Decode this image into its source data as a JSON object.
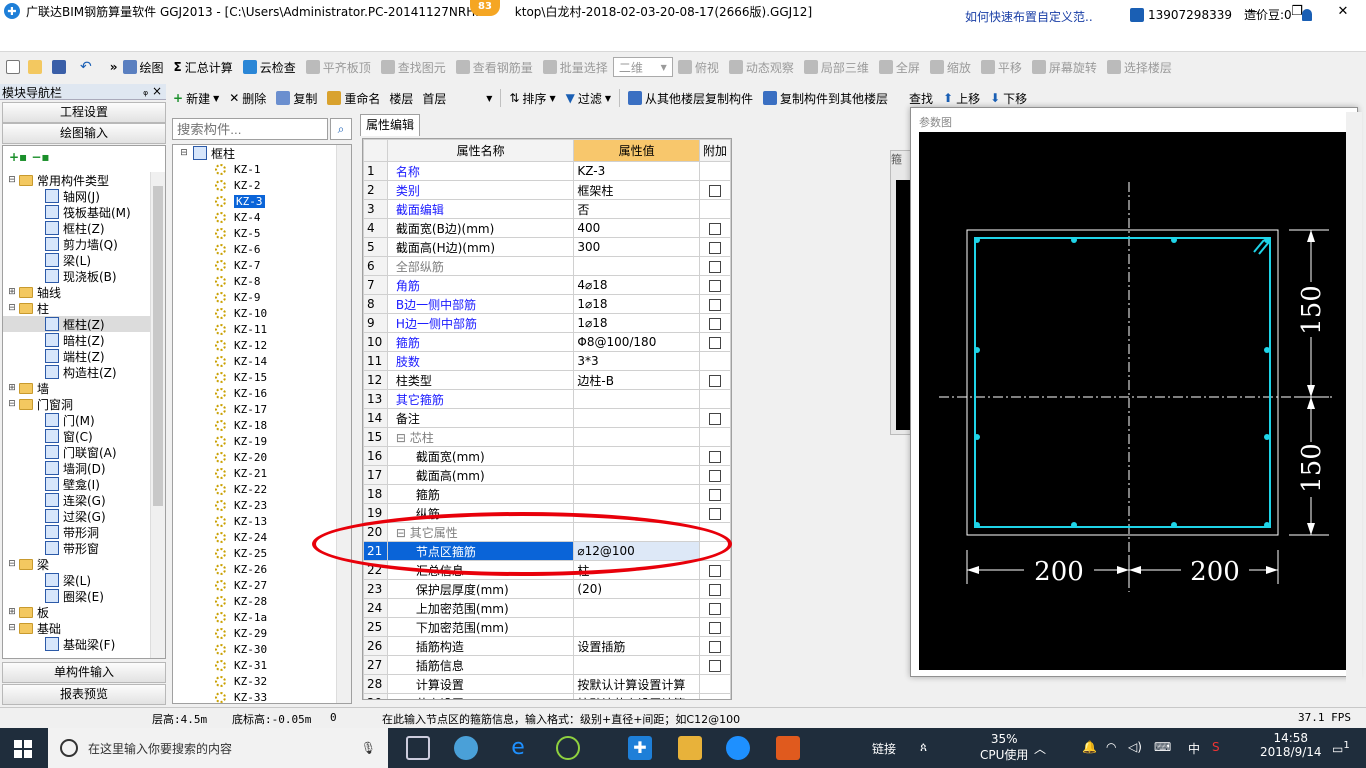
{
  "window": {
    "title": "广联达BIM钢筋算量软件 GGJ2013 - [C:\\Users\\Administrator.PC-20141127NRHI",
    "title_tail": "ktop\\白龙村-2018-02-03-20-08-17(2666版).GGJ12]",
    "badge": "83",
    "min": "—",
    "max": "❐",
    "close": "✕"
  },
  "infobar": {
    "tip": "如何快速布置自定义范..",
    "phone": "13907298339",
    "coins": "造价豆:0"
  },
  "toolbar1": {
    "draw": "绘图",
    "sum": "汇总计算",
    "cloud": "云检查",
    "flat": "平齐板顶",
    "find": "查找图元",
    "view_rebar": "查看钢筋量",
    "batch": "批量选择",
    "view2d": "二维",
    "topview": "俯视",
    "dynamic": "动态观察",
    "local3d": "局部三维",
    "fullscreen": "全屏",
    "zoom": "缩放",
    "pan": "平移",
    "rotate": "屏幕旋转",
    "select_floor": "选择楼层"
  },
  "toolbar2": {
    "new": "新建",
    "delete": "删除",
    "copy": "复制",
    "rename": "重命名",
    "floor_label": "楼层",
    "floor_value": "首层",
    "sort": "排序",
    "filter": "过滤",
    "copy_from": "从其他楼层复制构件",
    "copy_to": "复制构件到其他楼层",
    "find": "查找",
    "up": "上移",
    "down": "下移"
  },
  "nav": {
    "header": "模块导航栏",
    "pin": "ᵩ ×",
    "project_settings": "工程设置",
    "draw_input": "绘图输入",
    "single_input": "单构件输入",
    "report": "报表预览",
    "tree": [
      {
        "level": 0,
        "exp": "⊟",
        "type": "folder",
        "label": "常用构件类型"
      },
      {
        "level": 1,
        "exp": "",
        "type": "icon",
        "label": "轴网(J)"
      },
      {
        "level": 1,
        "exp": "",
        "type": "icon",
        "label": "筏板基础(M)"
      },
      {
        "level": 1,
        "exp": "",
        "type": "icon",
        "label": "框柱(Z)"
      },
      {
        "level": 1,
        "exp": "",
        "type": "icon",
        "label": "剪力墙(Q)"
      },
      {
        "level": 1,
        "exp": "",
        "type": "icon",
        "label": "梁(L)"
      },
      {
        "level": 1,
        "exp": "",
        "type": "icon",
        "label": "现浇板(B)"
      },
      {
        "level": 0,
        "exp": "⊞",
        "type": "folder",
        "label": "轴线"
      },
      {
        "level": 0,
        "exp": "⊟",
        "type": "folder",
        "label": "柱"
      },
      {
        "level": 1,
        "exp": "",
        "type": "icon",
        "label": "框柱(Z)",
        "selected": true
      },
      {
        "level": 1,
        "exp": "",
        "type": "icon",
        "label": "暗柱(Z)"
      },
      {
        "level": 1,
        "exp": "",
        "type": "icon",
        "label": "端柱(Z)"
      },
      {
        "level": 1,
        "exp": "",
        "type": "icon",
        "label": "构造柱(Z)"
      },
      {
        "level": 0,
        "exp": "⊞",
        "type": "folder",
        "label": "墙"
      },
      {
        "level": 0,
        "exp": "⊟",
        "type": "folder",
        "label": "门窗洞"
      },
      {
        "level": 1,
        "exp": "",
        "type": "icon",
        "label": "门(M)"
      },
      {
        "level": 1,
        "exp": "",
        "type": "icon",
        "label": "窗(C)"
      },
      {
        "level": 1,
        "exp": "",
        "type": "icon",
        "label": "门联窗(A)"
      },
      {
        "level": 1,
        "exp": "",
        "type": "icon",
        "label": "墙洞(D)"
      },
      {
        "level": 1,
        "exp": "",
        "type": "icon",
        "label": "壁龛(I)"
      },
      {
        "level": 1,
        "exp": "",
        "type": "icon",
        "label": "连梁(G)"
      },
      {
        "level": 1,
        "exp": "",
        "type": "icon",
        "label": "过梁(G)"
      },
      {
        "level": 1,
        "exp": "",
        "type": "icon",
        "label": "带形洞"
      },
      {
        "level": 1,
        "exp": "",
        "type": "icon",
        "label": "带形窗"
      },
      {
        "level": 0,
        "exp": "⊟",
        "type": "folder",
        "label": "梁"
      },
      {
        "level": 1,
        "exp": "",
        "type": "icon",
        "label": "梁(L)"
      },
      {
        "level": 1,
        "exp": "",
        "type": "icon",
        "label": "圈梁(E)"
      },
      {
        "level": 0,
        "exp": "⊞",
        "type": "folder",
        "label": "板"
      },
      {
        "level": 0,
        "exp": "⊟",
        "type": "folder",
        "label": "基础"
      },
      {
        "level": 1,
        "exp": "",
        "type": "icon",
        "label": "基础梁(F)"
      }
    ]
  },
  "components": {
    "search_placeholder": "搜索构件...",
    "root": "框柱",
    "items": [
      "KZ-1",
      "KZ-2",
      "KZ-3",
      "KZ-4",
      "KZ-5",
      "KZ-6",
      "KZ-7",
      "KZ-8",
      "KZ-9",
      "KZ-10",
      "KZ-11",
      "KZ-12",
      "KZ-14",
      "KZ-15",
      "KZ-16",
      "KZ-17",
      "KZ-18",
      "KZ-19",
      "KZ-20",
      "KZ-21",
      "KZ-22",
      "KZ-23",
      "KZ-13",
      "KZ-24",
      "KZ-25",
      "KZ-26",
      "KZ-27",
      "KZ-28",
      "KZ-1a",
      "KZ-29",
      "KZ-30",
      "KZ-31",
      "KZ-32",
      "KZ-33"
    ],
    "selected": "KZ-3"
  },
  "props": {
    "tab": "属性编辑",
    "col_name": "属性名称",
    "col_value": "属性值",
    "col_add": "附加",
    "rows": [
      {
        "n": "1",
        "name": "名称",
        "value": "KZ-3",
        "cls": "blue",
        "cb": false,
        "indent": 0
      },
      {
        "n": "2",
        "name": "类别",
        "value": "框架柱",
        "cls": "blue",
        "cb": true,
        "indent": 0
      },
      {
        "n": "3",
        "name": "截面编辑",
        "value": "否",
        "cls": "blue",
        "cb": false,
        "indent": 0
      },
      {
        "n": "4",
        "name": "截面宽(B边)(mm)",
        "value": "400",
        "cls": "",
        "cb": true,
        "indent": 0
      },
      {
        "n": "5",
        "name": "截面高(H边)(mm)",
        "value": "300",
        "cls": "",
        "cb": true,
        "indent": 0
      },
      {
        "n": "6",
        "name": "全部纵筋",
        "value": "",
        "cls": "gray",
        "cb": true,
        "indent": 0
      },
      {
        "n": "7",
        "name": "角筋",
        "value": "4⌀18",
        "cls": "blue",
        "cb": true,
        "indent": 0
      },
      {
        "n": "8",
        "name": "B边一侧中部筋",
        "value": "1⌀18",
        "cls": "blue",
        "cb": true,
        "indent": 0
      },
      {
        "n": "9",
        "name": "H边一侧中部筋",
        "value": "1⌀18",
        "cls": "blue",
        "cb": true,
        "indent": 0
      },
      {
        "n": "10",
        "name": "箍筋",
        "value": "Φ8@100/180",
        "cls": "blue",
        "cb": true,
        "indent": 0
      },
      {
        "n": "11",
        "name": "肢数",
        "value": "3*3",
        "cls": "blue",
        "cb": false,
        "indent": 0
      },
      {
        "n": "12",
        "name": "柱类型",
        "value": "边柱-B",
        "cls": "",
        "cb": true,
        "indent": 0
      },
      {
        "n": "13",
        "name": "其它箍筋",
        "value": "",
        "cls": "blue",
        "cb": false,
        "indent": 0
      },
      {
        "n": "14",
        "name": "备注",
        "value": "",
        "cls": "",
        "cb": true,
        "indent": 0
      },
      {
        "n": "15",
        "name": "⊟ 芯柱",
        "value": "",
        "cls": "gray",
        "cb": false,
        "indent": 0
      },
      {
        "n": "16",
        "name": "截面宽(mm)",
        "value": "",
        "cls": "",
        "cb": true,
        "indent": 1
      },
      {
        "n": "17",
        "name": "截面高(mm)",
        "value": "",
        "cls": "",
        "cb": true,
        "indent": 1
      },
      {
        "n": "18",
        "name": "箍筋",
        "value": "",
        "cls": "",
        "cb": true,
        "indent": 1
      },
      {
        "n": "19",
        "name": "纵筋",
        "value": "",
        "cls": "",
        "cb": true,
        "indent": 1
      },
      {
        "n": "20",
        "name": "⊟ 其它属性",
        "value": "",
        "cls": "gray",
        "cb": false,
        "indent": 0
      },
      {
        "n": "21",
        "name": "节点区箍筋",
        "value": "⌀12@100",
        "cls": "",
        "cb": false,
        "indent": 1,
        "hi": true
      },
      {
        "n": "22",
        "name": "汇总信息",
        "value": "柱",
        "cls": "",
        "cb": true,
        "indent": 1
      },
      {
        "n": "23",
        "name": "保护层厚度(mm)",
        "value": "(20)",
        "cls": "",
        "cb": true,
        "indent": 1
      },
      {
        "n": "24",
        "name": "上加密范围(mm)",
        "value": "",
        "cls": "",
        "cb": true,
        "indent": 1
      },
      {
        "n": "25",
        "name": "下加密范围(mm)",
        "value": "",
        "cls": "",
        "cb": true,
        "indent": 1
      },
      {
        "n": "26",
        "name": "插筋构造",
        "value": "设置插筋",
        "cls": "",
        "cb": true,
        "indent": 1
      },
      {
        "n": "27",
        "name": "插筋信息",
        "value": "",
        "cls": "",
        "cb": true,
        "indent": 1
      },
      {
        "n": "28",
        "name": "计算设置",
        "value": "按默认计算设置计算",
        "cls": "",
        "cb": false,
        "indent": 1
      },
      {
        "n": "29",
        "name": "节点设置",
        "value": "按默认节点设置计算",
        "cls": "",
        "cb": false,
        "indent": 1
      }
    ]
  },
  "param": {
    "title": "参数图",
    "side_label": "箍",
    "dim_b_left": "200",
    "dim_b_right": "200",
    "dim_h_top": "150",
    "dim_h_bottom": "150",
    "color_line": "#1fd4e8"
  },
  "status": {
    "floor_height": "层高:4.5m",
    "base_height": "底标高:-0.05m",
    "zero": "0",
    "hint": "在此输入节点区的箍筋信息，输入格式：级别+直径+间距；如C12@100",
    "fps": "37.1 FPS"
  },
  "taskbar": {
    "search": "在这里输入你要搜索的内容",
    "link": "链接",
    "cpu_pct": "35%",
    "cpu_label": "CPU使用",
    "ime": "中",
    "time": "14:58",
    "date": "2018/9/14",
    "notif": "1"
  }
}
